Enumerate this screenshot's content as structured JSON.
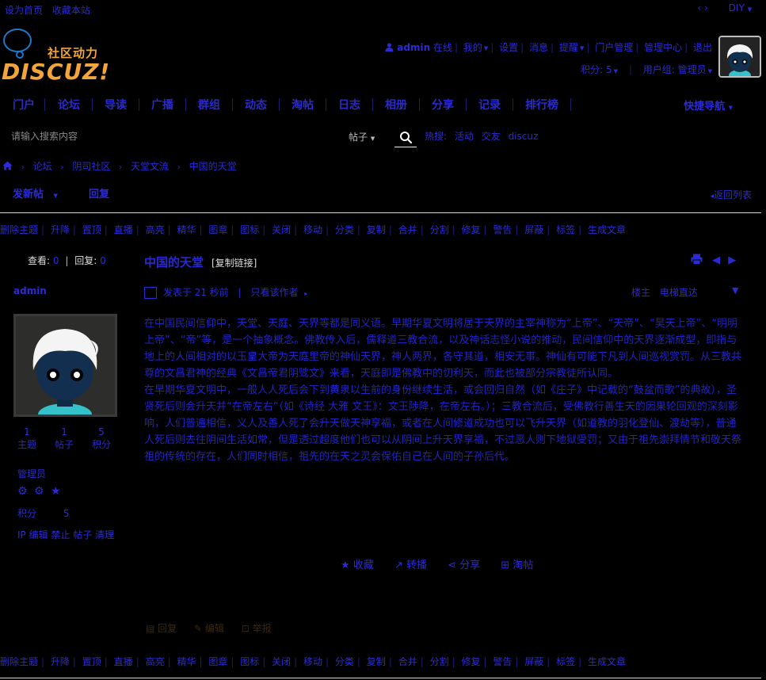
{
  "topbar": {
    "set_home": "设为首页",
    "favorite_site": "收藏本站",
    "arrows": "‹ ›",
    "diy": "DIY"
  },
  "logo": {
    "cn_text": "社区动力",
    "word": "DISCUZ!"
  },
  "user": {
    "name": "admin",
    "online": "在线",
    "mine": "我的",
    "settings": "设置",
    "messages": "消息",
    "reminders": "提醒",
    "portal_admin": "门户管理",
    "admin_center": "管理中心",
    "logout": "退出",
    "points_label": "积分: 5",
    "user_group": "用户组: 管理员"
  },
  "nav": {
    "items": [
      "门户",
      "论坛",
      "导读",
      "广播",
      "群组",
      "动态",
      "淘帖",
      "日志",
      "相册",
      "分享",
      "记录",
      "排行榜"
    ],
    "quick": "快捷导航"
  },
  "search": {
    "placeholder": "请输入搜索内容",
    "type": "帖子",
    "hot_label": "热搜:",
    "hot_terms": [
      "活动",
      "交友",
      "discuz"
    ]
  },
  "breadcrumb": [
    "论坛",
    "阴司社区",
    "天堂文流",
    "中国的天堂"
  ],
  "actions": {
    "new_post": "发新帖",
    "reply": "回复",
    "back_list": "返回列表"
  },
  "mod_actions": [
    "删除主题",
    "升降",
    "置顶",
    "直播",
    "高亮",
    "精华",
    "图章",
    "图标",
    "关闭",
    "移动",
    "分类",
    "复制",
    "合并",
    "分割",
    "修复",
    "警告",
    "屏蔽",
    "标签",
    "生成文章"
  ],
  "stats": {
    "views_label": "查看:",
    "views": "0",
    "replies_label": "回复:",
    "replies": "0"
  },
  "author": {
    "name": "admin",
    "topics": "1",
    "posts": "1",
    "points": "5",
    "topics_label": "主题",
    "posts_label": "帖子",
    "points_label": "积分",
    "group": "管理员",
    "points_row_label": "积分",
    "points_row_value": "5",
    "links": [
      "IP",
      "编辑",
      "禁止",
      "帖子",
      "清理"
    ]
  },
  "post": {
    "title": "中国的天堂",
    "copy_link": "[复制链接]",
    "posted": "发表于 21 秒前",
    "author_only": "只看该作者",
    "floor": "楼主",
    "jump": "电梯直达",
    "paragraphs": [
      "在中国民间信仰中，天堂、天庭、天界等都是同义语。早期华夏文明将居于天界的主宰神称为“上帝”、“天帝”、“昊天上帝”、“明明上帝”、“帝”等，是一个抽象概念。佛教传入后，儒释道三教合流，以及神话志怪小说的推动，民间信仰中的天界逐渐成型，即指与地上的人间相对的以玉皇大帝为天庭里帝的神仙天界，神人两界，各守其道，相安无事。神仙有可能下凡到人间巡视赏罚。从三教共尊的文昌君神的经典《文昌帝君阴骘文》来看，天庭即是佛教中的忉利天，而此也被部分宗教徒所认同。",
      "在早期华夏文明中，一般人人死后会下到黄泉以生前的身份继续生活，或会回归自然（如《庄子》中记载的“鼓盆而歌”的典故），圣贤死后则会升天并“在帝左右”（如《诗经 大雅 文王》：文王陟降，在帝左右。）；三教合流后，受佛教行善生天的因果轮回观的深刻影响，人们普遍相信，义人及善人死了会升天做天神享福，或者在人间修道成功也可以飞升天界（如道教的羽化登仙、渡劫等），普通人死后则去往阴间生活如常，但是透过超度他们也可以从阴间上升天界享福，不过恶人则下地狱受罚；又由于祖先崇拜情节和敬天祭祖的传统的存在，人们同时相信，祖先的在天之灵会保佑自己在人间的子孙后代。"
    ],
    "actions": [
      "收藏",
      "转播",
      "分享",
      "淘帖"
    ],
    "reply_actions": [
      "回复",
      "编辑",
      "举报"
    ]
  },
  "colors": {
    "background": "#000000",
    "link": "#2b2bd6",
    "logo_orange": "#f2a53a",
    "logo_blue": "#1d78c9"
  }
}
